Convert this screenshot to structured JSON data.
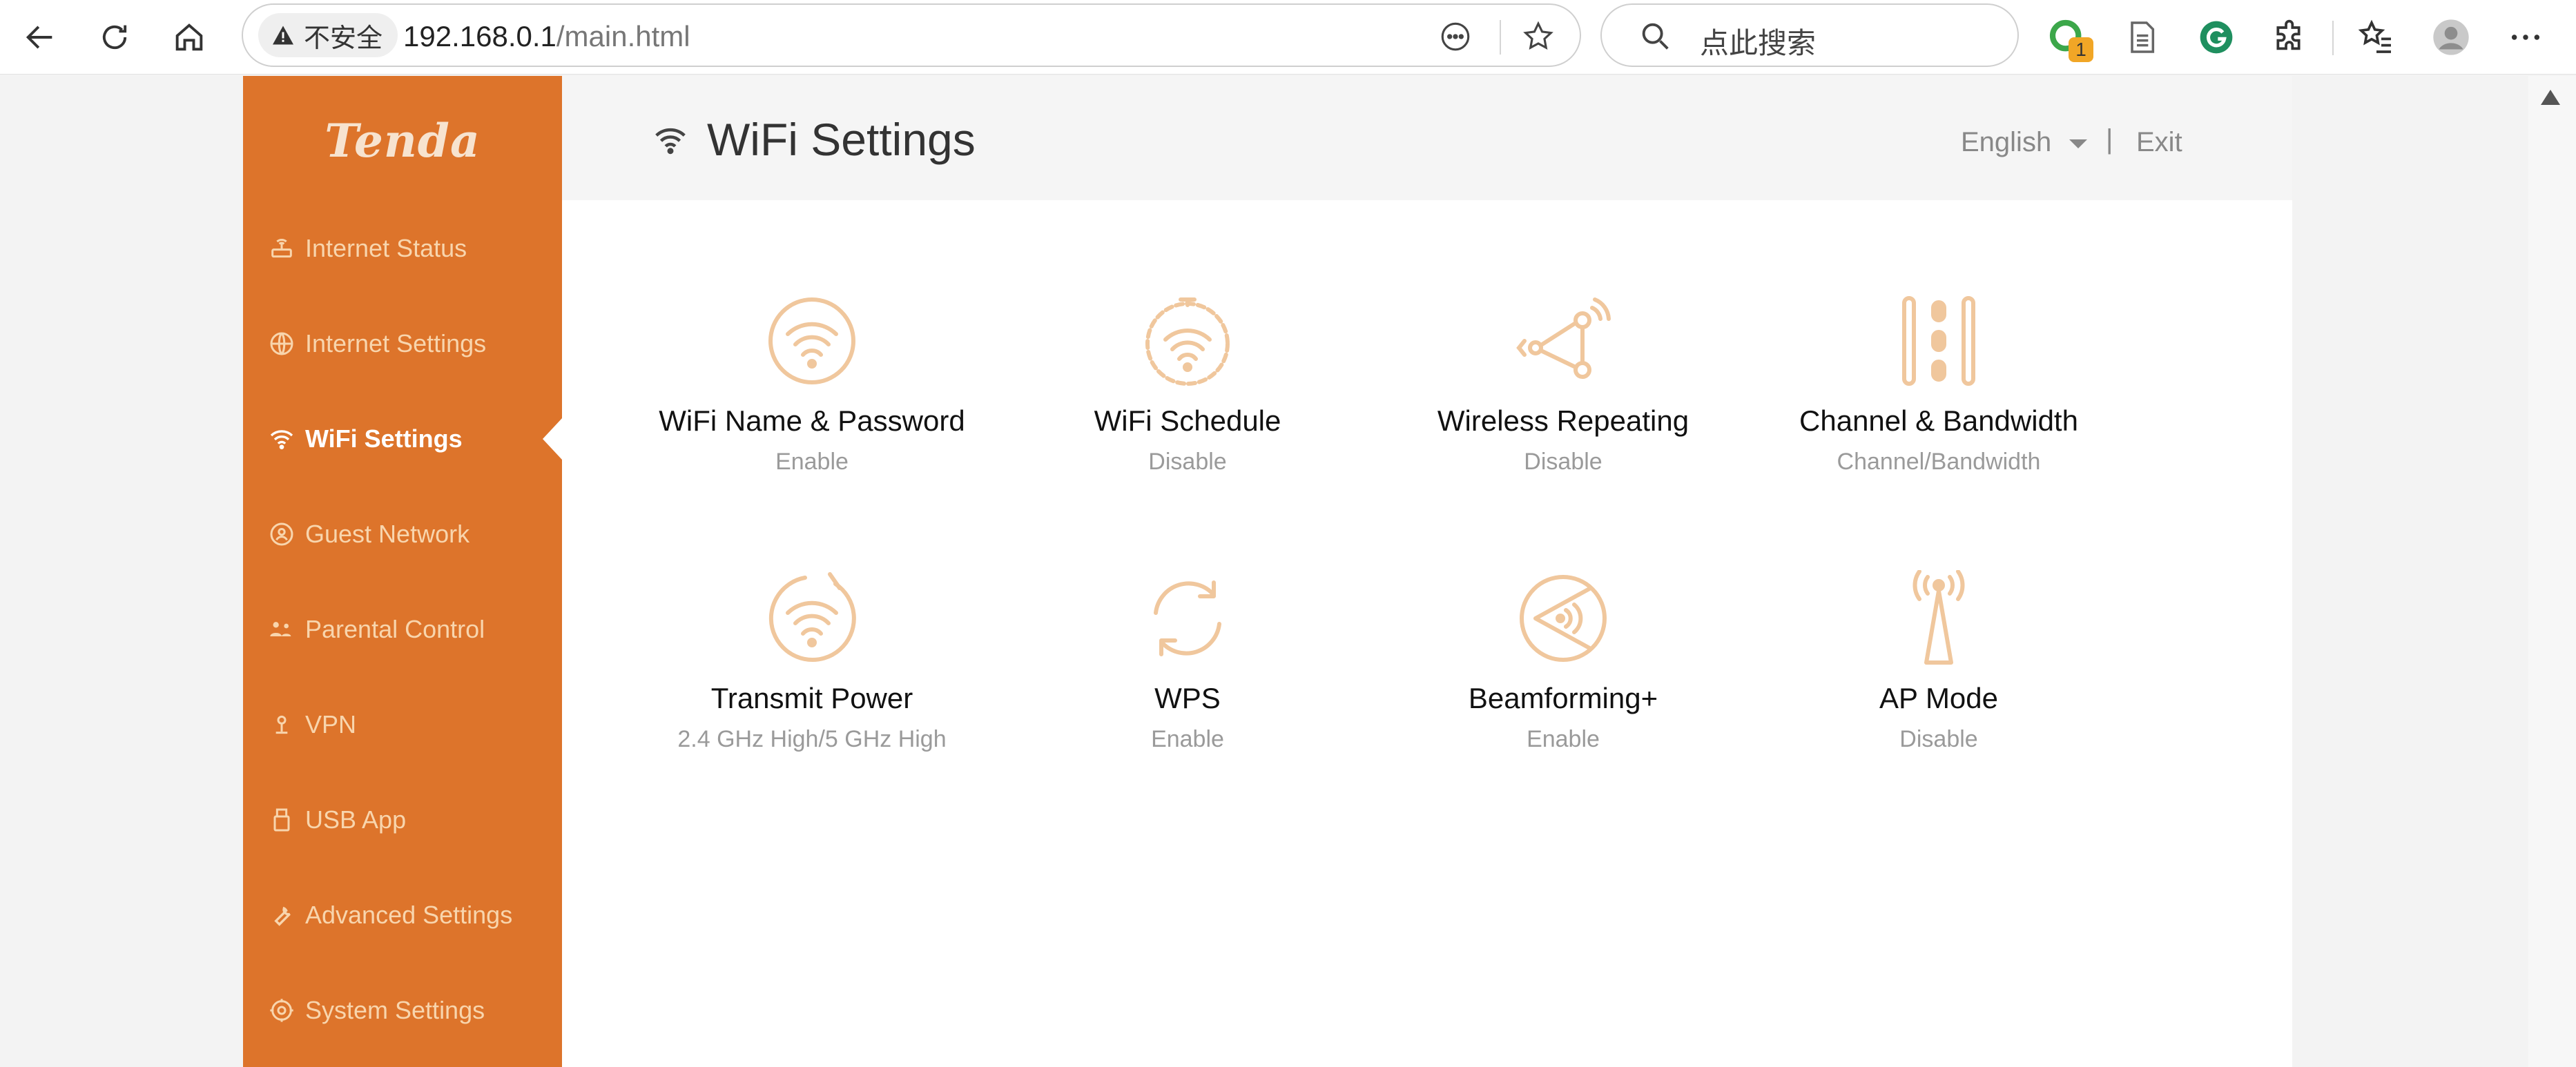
{
  "browser": {
    "security_label": "不安全",
    "url_host": "192.168.0.1",
    "url_path": "/main.html",
    "search_placeholder": "点此搜索",
    "extension_badge": "1"
  },
  "sidebar": {
    "logo": "Tenda",
    "items": [
      {
        "label": "Internet Status",
        "icon": "router-icon"
      },
      {
        "label": "Internet Settings",
        "icon": "globe-icon"
      },
      {
        "label": "WiFi Settings",
        "icon": "wifi-icon",
        "active": true
      },
      {
        "label": "Guest Network",
        "icon": "guest-icon"
      },
      {
        "label": "Parental Control",
        "icon": "family-icon"
      },
      {
        "label": "VPN",
        "icon": "vpn-icon"
      },
      {
        "label": "USB App",
        "icon": "usb-icon"
      },
      {
        "label": "Advanced Settings",
        "icon": "wrench-icon"
      },
      {
        "label": "System Settings",
        "icon": "gear-icon"
      }
    ]
  },
  "header": {
    "title": "WiFi Settings",
    "language": "English",
    "separator": "|",
    "exit": "Exit"
  },
  "cards": [
    {
      "title": "WiFi Name & Password",
      "status": "Enable",
      "icon": "wifi-circle-icon"
    },
    {
      "title": "WiFi Schedule",
      "status": "Disable",
      "icon": "wifi-timer-icon"
    },
    {
      "title": "Wireless Repeating",
      "status": "Disable",
      "icon": "repeater-icon"
    },
    {
      "title": "Channel & Bandwidth",
      "status": "Channel/Bandwidth",
      "icon": "channel-icon"
    },
    {
      "title": "Transmit Power",
      "status": "2.4 GHz High/5 GHz High",
      "icon": "power-wifi-icon"
    },
    {
      "title": "WPS",
      "status": "Enable",
      "icon": "wps-icon"
    },
    {
      "title": "Beamforming+",
      "status": "Enable",
      "icon": "beamforming-icon"
    },
    {
      "title": "AP Mode",
      "status": "Disable",
      "icon": "antenna-icon"
    }
  ],
  "colors": {
    "sidebar": "#dd742b",
    "icon": "#f0c79d",
    "status": "#9a9a9a"
  }
}
